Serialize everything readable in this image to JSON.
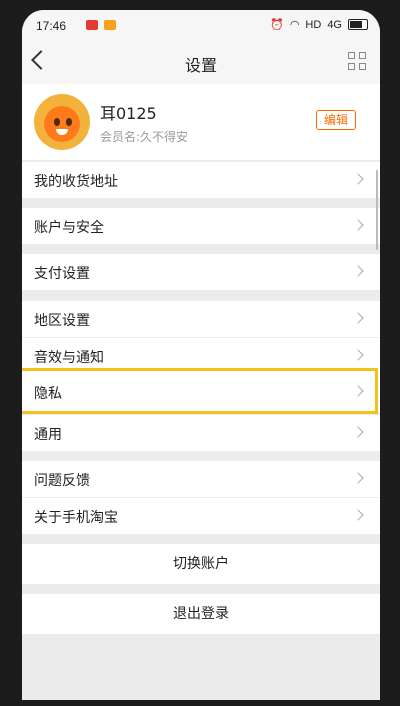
{
  "status_bar": {
    "time": "17:46",
    "network": "HD",
    "signal": "4G"
  },
  "nav": {
    "title": "设置"
  },
  "profile": {
    "name": "耳0125",
    "member_name": "会员名:久不得安",
    "edit_label": "编辑"
  },
  "menu": {
    "address": "我的收货地址",
    "account_security": "账户与安全",
    "payment": "支付设置",
    "region": "地区设置",
    "sound_notify": "音效与通知",
    "privacy": "隐私",
    "general": "通用",
    "feedback": "问题反馈",
    "about": "关于手机淘宝"
  },
  "actions": {
    "switch_account": "切换账户",
    "logout": "退出登录"
  },
  "colors": {
    "accent": "#ff6a00",
    "highlight": "#f4c21a"
  }
}
